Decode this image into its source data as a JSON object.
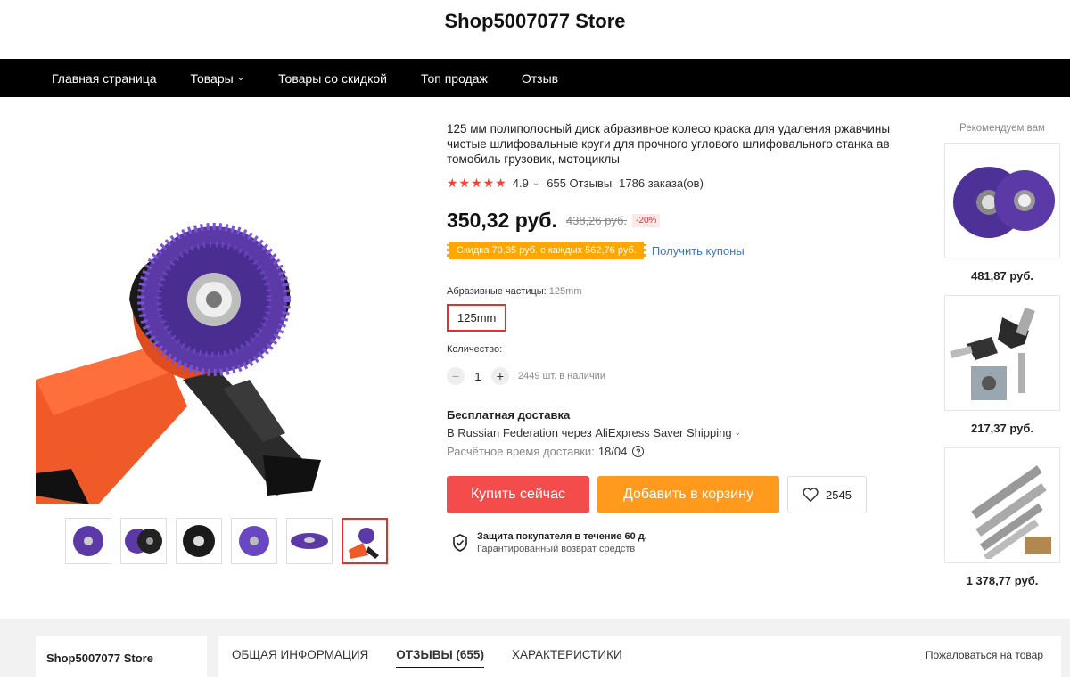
{
  "store": {
    "title": "Shop5007077 Store"
  },
  "nav": {
    "items": [
      "Главная страница",
      "Товары",
      "Товары со скидкой",
      "Топ продаж",
      "Отзыв"
    ]
  },
  "product": {
    "title": "125 мм полиполосный диск абразивное колесо краска для удаления ржавчины чистые шлифовальные круги для прочного углового шлифовального станка ав томобиль грузовик, мотоциклы",
    "rating": "4.9",
    "reviews": "655 Отзывы",
    "orders": "1786 заказа(ов)",
    "price": "350,32 руб.",
    "old_price": "438,26 руб.",
    "discount": "-20%",
    "coupon": "Скидка 70,35 руб. с каждых 562,76 руб.",
    "coupon_link": "Получить купоны",
    "attr_label": "Абразивные частицы:",
    "attr_value": "125mm",
    "sku_option": "125mm",
    "qty_label": "Количество:",
    "qty_value": "1",
    "stock": "2449 шт. в наличии",
    "shipping_title": "Бесплатная доставка",
    "shipping_line": "В Russian Federation через AliExpress Saver Shipping",
    "delivery_label": "Расчётное время доставки:",
    "delivery_date": "18/04",
    "buy_label": "Купить сейчас",
    "cart_label": "Добавить в корзину",
    "wishlist_count": "2545",
    "protect_title": "Защита покупателя в течение 60 д.",
    "protect_sub": "Гарантированный возврат средств"
  },
  "recommend": {
    "title": "Рекомендуем вам",
    "items": [
      {
        "price": "481,87 руб."
      },
      {
        "price": "217,37 руб."
      },
      {
        "price": "1 378,77 руб."
      }
    ]
  },
  "bottom": {
    "store_name": "Shop5007077 Store",
    "tabs": [
      "ОБЩАЯ ИНФОРМАЦИЯ",
      "ОТЗЫВЫ (655)",
      "ХАРАКТЕРИСТИКИ"
    ],
    "report": "Пожаловаться на товар"
  },
  "colors": {
    "accent_red": "#f44b4b",
    "accent_orange": "#ff9a1c",
    "coupon_bg": "#ffa600",
    "link_blue": "#3a78c3",
    "nav_bg": "#000000"
  }
}
